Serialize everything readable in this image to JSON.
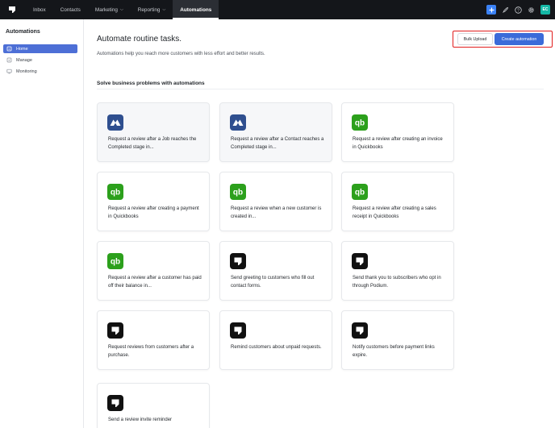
{
  "topnav": {
    "items": [
      {
        "label": "Inbox",
        "active": false,
        "dropdown": false
      },
      {
        "label": "Contacts",
        "active": false,
        "dropdown": false
      },
      {
        "label": "Marketing",
        "active": false,
        "dropdown": true
      },
      {
        "label": "Reporting",
        "active": false,
        "dropdown": true
      },
      {
        "label": "Automations",
        "active": true,
        "dropdown": false
      }
    ],
    "avatar_initials": "EC",
    "colors": {
      "bar": "#14161a",
      "plus": "#3b82f6",
      "avatar": "#14b8a6"
    }
  },
  "sidebar": {
    "title": "Automations",
    "items": [
      {
        "label": "Home",
        "active": true,
        "icon": "home-icon"
      },
      {
        "label": "Manage",
        "active": false,
        "icon": "manage-icon"
      },
      {
        "label": "Monitoring",
        "active": false,
        "icon": "monitoring-icon"
      }
    ]
  },
  "main": {
    "title": "Automate routine tasks.",
    "subtitle": "Automations help you reach more customers with less effort and better results.",
    "bulk_upload_label": "Bulk Upload",
    "create_label": "Create automation",
    "section_title": "Solve business problems with automations",
    "cards": [
      {
        "text": "Request a review after a Job reaches the Completed stage in...",
        "icon": "jobber-icon"
      },
      {
        "text": "Request a review after a Contact reaches a Completed stage in...",
        "icon": "jobber-icon"
      },
      {
        "text": "Request a review after creating an invoice in Quickbooks",
        "icon": "quickbooks-icon"
      },
      {
        "text": "Request a review after creating a payment in Quickbooks",
        "icon": "quickbooks-icon"
      },
      {
        "text": "Request a review when a new customer is created in...",
        "icon": "quickbooks-icon"
      },
      {
        "text": "Request a review after creating a sales receipt in Quickbooks",
        "icon": "quickbooks-icon"
      },
      {
        "text": "Request a review after a customer has paid off their balance in...",
        "icon": "quickbooks-icon"
      },
      {
        "text": "Send greeting to customers who fill out contact forms.",
        "icon": "podium-icon"
      },
      {
        "text": "Send thank you to subscribers who opt in through Podium.",
        "icon": "podium-icon"
      },
      {
        "text": "Request reviews from customers after a purchase.",
        "icon": "podium-icon"
      },
      {
        "text": "Remind customers about unpaid requests.",
        "icon": "podium-icon"
      },
      {
        "text": "Notify customers before payment links expire.",
        "icon": "podium-icon"
      },
      {
        "text": "Send a review invite reminder",
        "icon": "podium-icon"
      }
    ]
  },
  "colors": {
    "accent": "#3b6bd9",
    "highlight_frame": "#e11d1d",
    "jobber": "#2f4f8f",
    "quickbooks": "#2ca01c",
    "podium": "#111111"
  }
}
